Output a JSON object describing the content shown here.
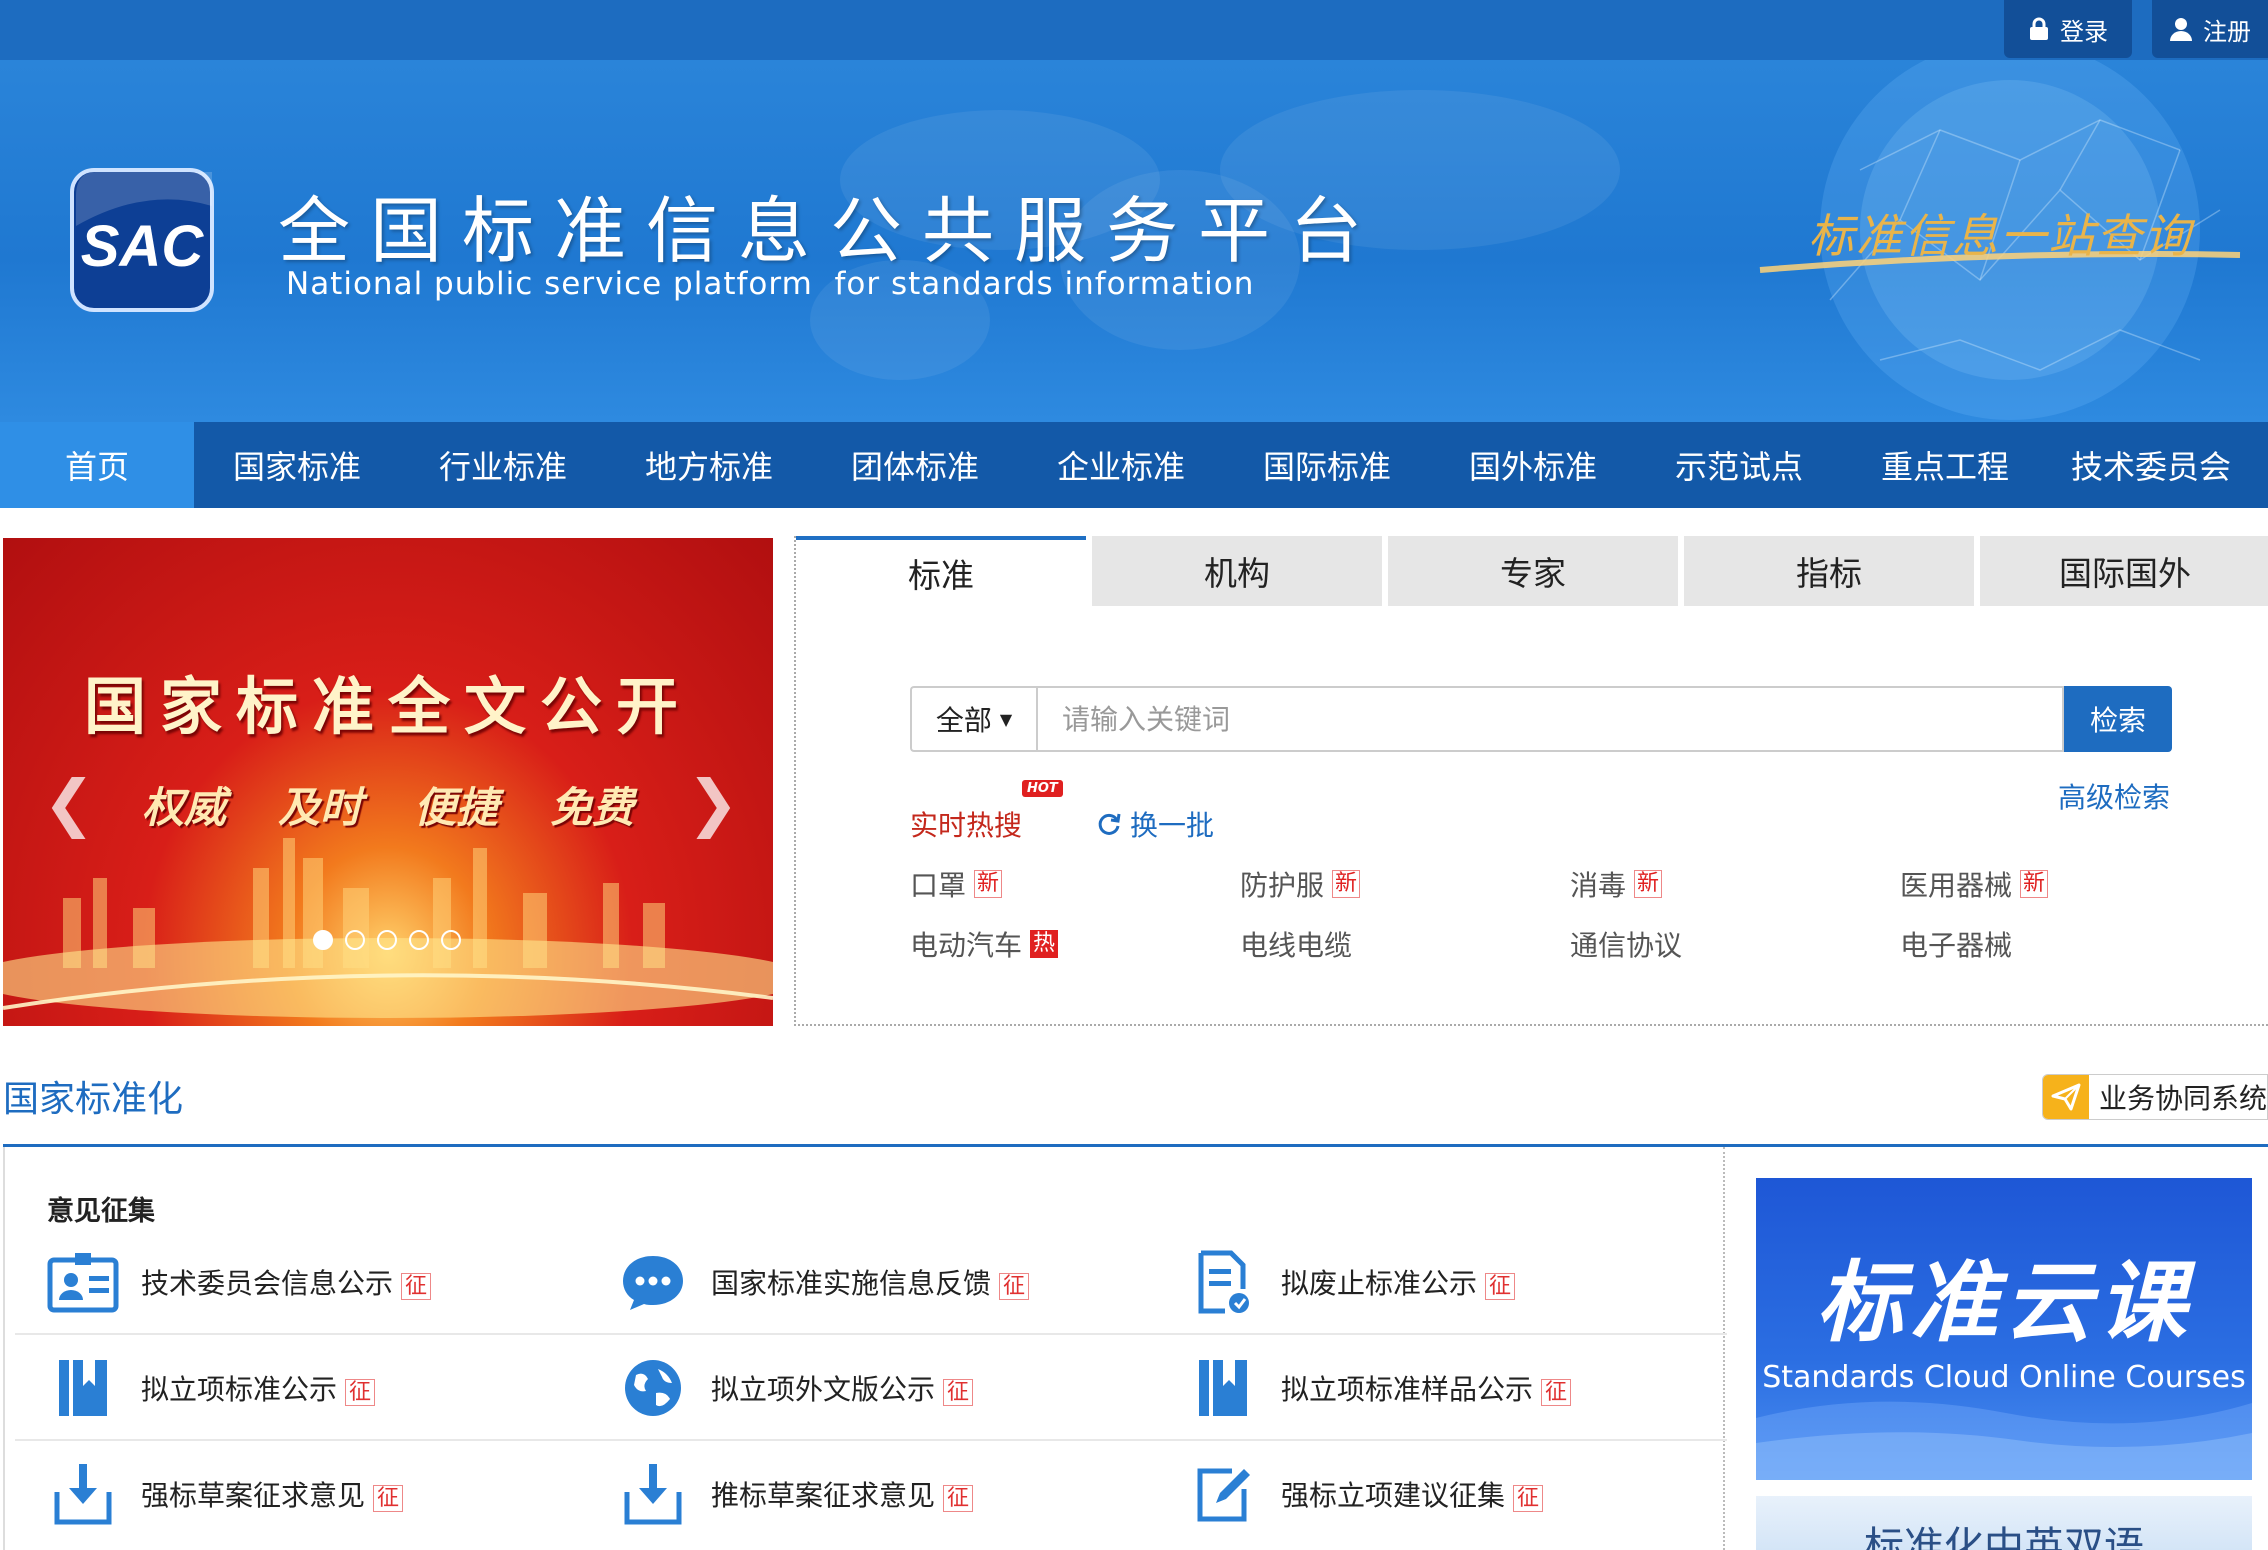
{
  "topbar": {
    "login_label": "登录",
    "register_label": "注册"
  },
  "banner": {
    "logo_text": "SAC",
    "title": "全国标准信息公共服务平台",
    "subtitle": "National public service platform  for standards information",
    "slogan": "标准信息一站查询"
  },
  "nav": {
    "items": [
      {
        "label": "首页",
        "active": true
      },
      {
        "label": "国家标准"
      },
      {
        "label": "行业标准"
      },
      {
        "label": "地方标准"
      },
      {
        "label": "团体标准"
      },
      {
        "label": "企业标准"
      },
      {
        "label": "国际标准"
      },
      {
        "label": "国外标准"
      },
      {
        "label": "示范试点"
      },
      {
        "label": "重点工程"
      },
      {
        "label": "技术委员会"
      }
    ]
  },
  "carousel": {
    "title": "国家标准全文公开",
    "subtitles": [
      "权威",
      "及时",
      "便捷",
      "免费"
    ],
    "active_slide": 1,
    "slide_count": 5
  },
  "search": {
    "tabs": [
      "标准",
      "机构",
      "专家",
      "指标",
      "国际国外"
    ],
    "active_tab": "标准",
    "scope_value": "全部",
    "placeholder": "请输入关键词",
    "button_label": "检索",
    "advanced_label": "高级检索",
    "hot_label": "实时热搜",
    "hot_badge": "HOT",
    "refresh_label": "换一批",
    "hot_items": [
      {
        "label": "口罩",
        "tag": "新",
        "tag_type": "new"
      },
      {
        "label": "防护服",
        "tag": "新",
        "tag_type": "new"
      },
      {
        "label": "消毒",
        "tag": "新",
        "tag_type": "new"
      },
      {
        "label": "医用器械",
        "tag": "新",
        "tag_type": "new"
      },
      {
        "label": "电动汽车",
        "tag": "热",
        "tag_type": "hot"
      },
      {
        "label": "电线电缆",
        "tag": "",
        "tag_type": ""
      },
      {
        "label": "通信协议",
        "tag": "",
        "tag_type": ""
      },
      {
        "label": "电子器械",
        "tag": "",
        "tag_type": ""
      }
    ]
  },
  "section": {
    "title": "国家标准化",
    "collab_label": "业务协同系统"
  },
  "opinions": {
    "title": "意见征集",
    "tag": "征",
    "items": [
      {
        "label": "技术委员会信息公示",
        "icon": "id-card-icon"
      },
      {
        "label": "国家标准实施信息反馈",
        "icon": "chat-bubble-icon"
      },
      {
        "label": "拟废止标准公示",
        "icon": "document-edit-icon"
      },
      {
        "label": "拟立项标准公示",
        "icon": "bookmark-book-icon"
      },
      {
        "label": "拟立项外文版公示",
        "icon": "globe-icon"
      },
      {
        "label": "拟立项标准样品公示",
        "icon": "bookmark-book-icon"
      },
      {
        "label": "强标草案征求意见",
        "icon": "download-tray-icon"
      },
      {
        "label": "推标草案征求意见",
        "icon": "download-tray-icon"
      },
      {
        "label": "强标立项建议征集",
        "icon": "pen-square-icon"
      }
    ]
  },
  "promo": {
    "title": "标准云课",
    "subtitle": "Standards Cloud Online Courses",
    "second_title": "标准化中英双语"
  },
  "colors": {
    "brand_blue": "#1d6cc0",
    "nav_blue": "#1359a8",
    "nav_active": "#2f8fe6",
    "hot_red": "#c4281c",
    "slogan_gold": "#e9b44a"
  }
}
